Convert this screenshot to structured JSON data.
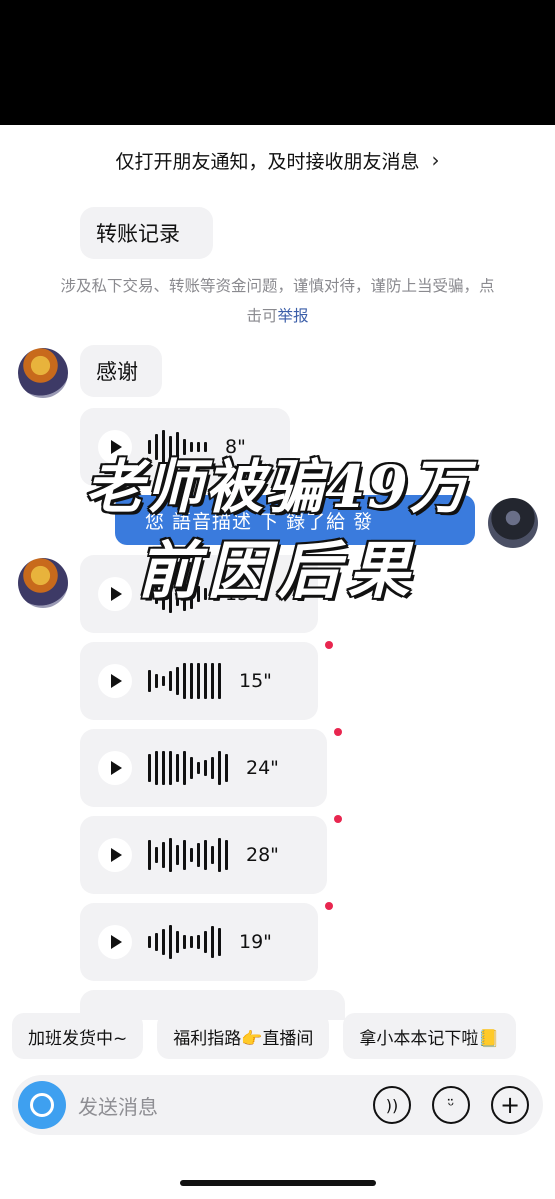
{
  "notify": {
    "text": "仅打开朋友通知，及时接收朋友消息",
    "chevron": "›"
  },
  "messages": {
    "transfer_record": "转账记录",
    "warning_text": "涉及私下交易、转账等资金问题，谨慎对待，谨防上当受骗，点击可",
    "warning_link": "举报",
    "thanks": "感谢",
    "blue_text": "您 語音描述 下 錄了給 發"
  },
  "voice_messages": [
    {
      "duration": "8\""
    },
    {
      "duration": "15\""
    },
    {
      "duration": "15\""
    },
    {
      "duration": "24\""
    },
    {
      "duration": "28\""
    },
    {
      "duration": "19\""
    }
  ],
  "overlay": {
    "line1": "老师被骗49万",
    "line2": "前因后果"
  },
  "quick_replies": [
    "加班发货中~",
    "福利指路👉直播间",
    "拿小本本记下啦📒"
  ],
  "input": {
    "placeholder": "发送消息"
  },
  "icons": {
    "camera": "camera-icon",
    "voice": "voice-icon",
    "emoji": "emoji-icon",
    "plus": "plus-icon"
  },
  "colors": {
    "accent_blue": "#3ea0f0",
    "unread_dot": "#e8264f",
    "blue_bubble": "#3a7bdd"
  }
}
